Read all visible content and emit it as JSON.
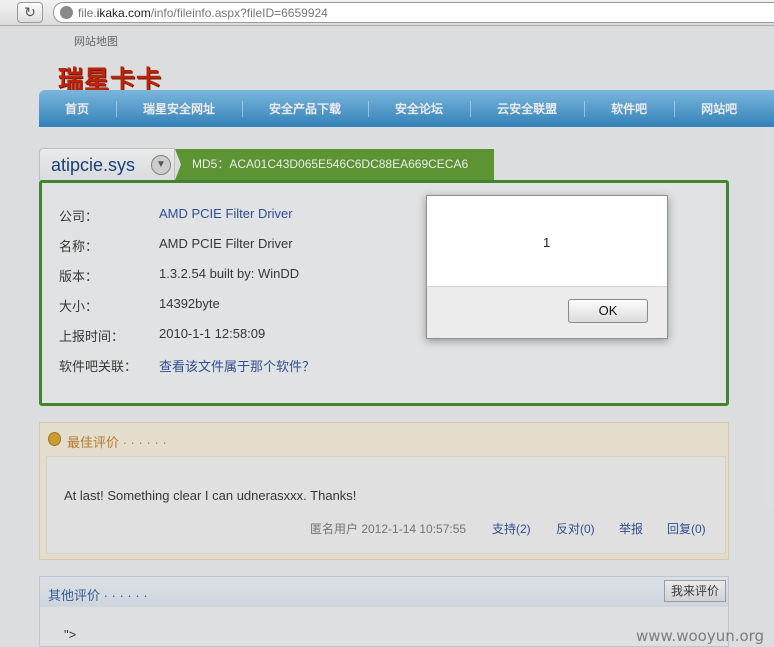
{
  "browser": {
    "url_prefix": "file.",
    "url_domain": "ikaka.com",
    "url_path": "/info/fileinfo.aspx?fileID=6659924"
  },
  "header": {
    "sitemap": "网站地图",
    "logo": "瑞星卡卡"
  },
  "nav": {
    "items": [
      "首页",
      "瑞星安全网址",
      "安全产品下载",
      "安全论坛",
      "云安全联盟",
      "软件吧",
      "网站吧"
    ]
  },
  "file": {
    "name": "atipcie.sys",
    "md5": "MD5：ACA01C43D065E546C6DC88EA669CECA6",
    "info": [
      {
        "label": "公司：",
        "value": "AMD PCIE Filter Driver"
      },
      {
        "label": "名称：",
        "value": "AMD PCIE Filter Driver"
      },
      {
        "label": "版本：",
        "value": "1.3.2.54 built by: WinDD"
      },
      {
        "label": "大小：",
        "value": "14392byte"
      },
      {
        "label": "上报时间：",
        "value": "2010-1-1 12:58:09"
      },
      {
        "label": "软件吧关联：",
        "value": "查看该文件属于那个软件？"
      }
    ]
  },
  "best_review": {
    "title": "最佳评价 · · · · · ·",
    "text": "At last! Something clear I can udnerasxxx. Thanks!",
    "user": "匿名用户 2012-1-14 10:57:55",
    "support": "支持(2)",
    "oppose": "反对(0)",
    "report": "举报",
    "reply": "回复(0)"
  },
  "other_reviews": {
    "title": "其他评价 · · · · · ·",
    "write_button": "我来评价",
    "text": "\">"
  },
  "dialog": {
    "message": "1",
    "ok_label": "OK"
  },
  "watermark": "www.wooyun.org"
}
